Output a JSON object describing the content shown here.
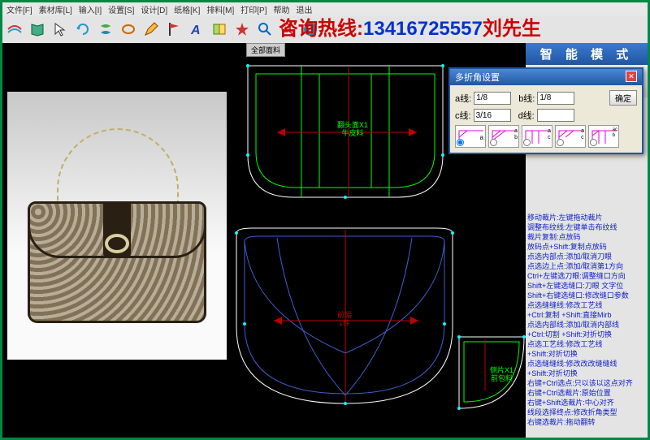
{
  "menu": {
    "items": [
      "文件[F]",
      "素材库[L]",
      "输入[I]",
      "设置[S]",
      "设计[D]",
      "纸格[K]",
      "排料[M]",
      "打印[P]",
      "帮助",
      "退出"
    ]
  },
  "overlay": {
    "part1": "咨询热线:",
    "part2": "13416725557",
    "part3": "刘先生"
  },
  "canvas": {
    "tab": "全部面料",
    "label_top1": "翻头面X1",
    "label_top2": "牛皮料",
    "label_mid1": "前幅",
    "label_mid2": "1件",
    "label_side1": "侧片X1",
    "label_side2": "前包料"
  },
  "smart": {
    "title": "智 能 模 式"
  },
  "dlg": {
    "title": "多折角设置",
    "a": "a线:",
    "a_val": "1/8",
    "b": "b线:",
    "b_val": "1/8",
    "c": "c线:",
    "c_val": "3/16",
    "d": "d线:",
    "d_val": "",
    "ok": "确定",
    "rad_a": "a",
    "rad_b": "b",
    "rad_c": "c"
  },
  "help": {
    "lines": [
      "移动裁片:左键拖动裁片",
      "调整布纹线:左键单击布纹线",
      "裁片复制:点放码",
      "放码点+Shift:复制点放码",
      "点选内部点:添加/取消刀眼",
      "点选边上点:添加/取消第1方向",
      "Ctrl+左键选刀眼:调整缝口方向",
      "Shift+左键选缝口:刀眼 文字位",
      "Shift+右键选缝口:修改缝口参数",
      "点选缝缝线:修改工艺线",
      "+Ctrl:复制 +Shift:直接Mirb",
      "点选内部线:添加/取消内部线",
      "+Ctrl:切割 +Shift:对折切换",
      "点选工艺线:修改工艺线",
      "+Shift:对折切换",
      "点选缝缝线:修改改改缝缝线",
      "+Shift:对折切换",
      "右键+Ctrl选点:只以该以这点对齐",
      "右键+Ctrl选裁片:原始位置",
      "右键+Shift选裁片:中心对齐",
      "线段选择终点:修改折角类型",
      "右键选裁片:拖动翻转"
    ]
  }
}
